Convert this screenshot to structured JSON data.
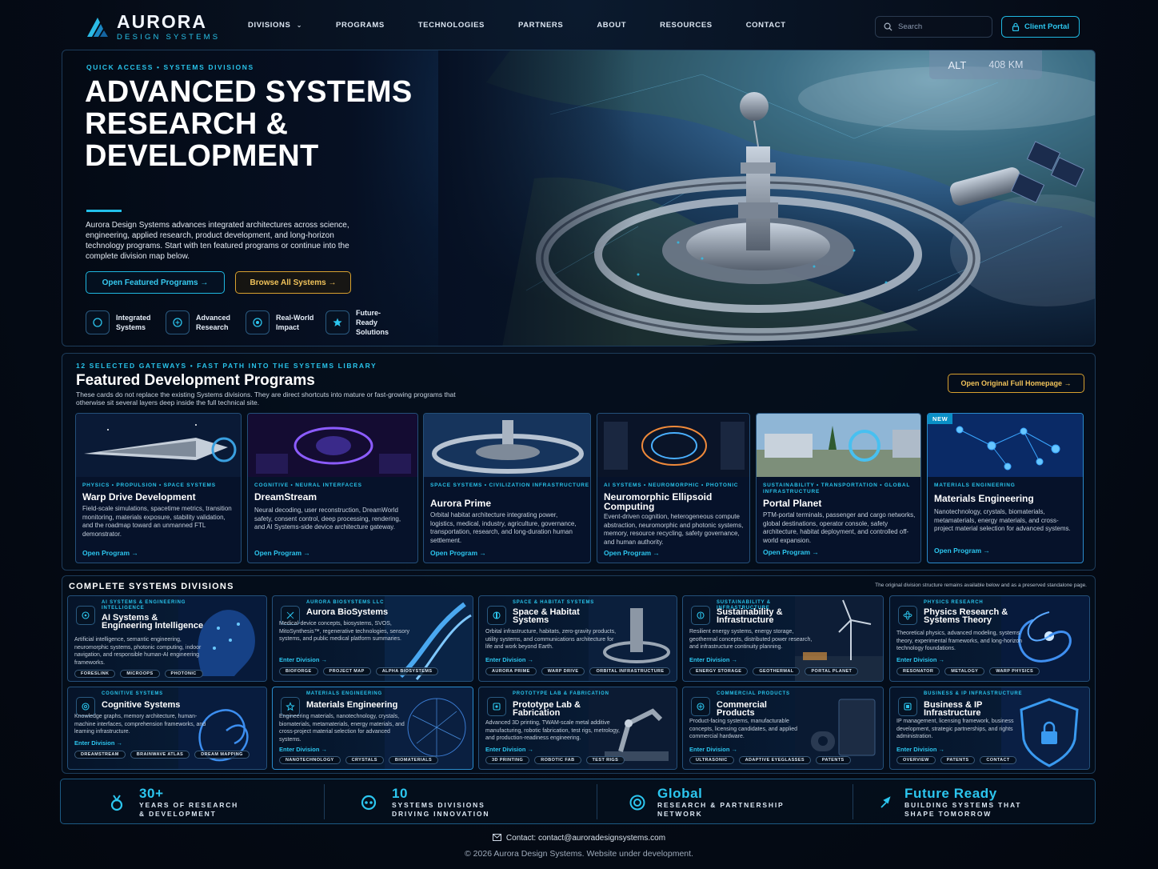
{
  "brand": {
    "name": "AURORA",
    "sub": "DESIGN SYSTEMS",
    "accent": "#28c3ea",
    "gold": "#d8a12f"
  },
  "nav": {
    "items": [
      "DIVISIONS",
      "PROGRAMS",
      "TECHNOLOGIES",
      "PARTNERS",
      "ABOUT",
      "RESOURCES",
      "CONTACT"
    ],
    "search_placeholder": "Search",
    "portal": "Client Portal"
  },
  "hero": {
    "kicker": "QUICK ACCESS • SYSTEMS DIVISIONS",
    "title": "ADVANCED SYSTEMS RESEARCH & DEVELOPMENT",
    "description": "Aurora Design Systems advances integrated architectures across science, engineering, applied research, product development, and long-horizon technology programs. Start with ten featured programs or continue into the complete division map below.",
    "btn_primary": "Open Featured Programs →",
    "btn_secondary": "Browse All Systems →",
    "alt_label": "ALT",
    "alt_value": "408 KM",
    "badges": [
      "Integrated Systems",
      "Advanced Research",
      "Real-World Impact",
      "Future-Ready Solutions"
    ]
  },
  "featured": {
    "kicker": "12 SELECTED GATEWAYS • FAST PATH INTO THE SYSTEMS LIBRARY",
    "title": "Featured Development Programs",
    "description": "These cards do not replace the existing Systems divisions. They are direct shortcuts into mature or fast-growing programs that otherwise sit several layers deep inside the full technical site.",
    "button": "Open Original Full Homepage →",
    "cards": [
      {
        "tag": "PHYSICS • PROPULSION • SPACE SYSTEMS",
        "title": "Warp Drive Development",
        "desc": "Field-scale simulations, spacetime metrics, transition monitoring, materials exposure, stability validation, and the roadmap toward an unmanned FTL demonstrator.",
        "link": "Open Program →"
      },
      {
        "tag": "COGNITIVE • NEURAL INTERFACES",
        "title": "DreamStream",
        "desc": "Neural decoding, user reconstruction, DreamWorld safety, consent control, deep processing, rendering, and AI Systems-side device architecture gateway.",
        "link": "Open Program →"
      },
      {
        "tag": "SPACE SYSTEMS • CIVILIZATION INFRASTRUCTURE",
        "title": "Aurora Prime",
        "desc": "Orbital habitat architecture integrating power, logistics, medical, industry, agriculture, governance, transportation, research, and long-duration human settlement.",
        "link": "Open Program →"
      },
      {
        "tag": "AI SYSTEMS • NEUROMORPHIC • PHOTONIC",
        "title": "Neuromorphic Ellipsoid Computing",
        "desc": "Event-driven cognition, heterogeneous compute abstraction, neuromorphic and photonic systems, memory, resource recycling, safety governance, and human authority.",
        "link": "Open Program →"
      },
      {
        "tag": "SUSTAINABILITY • TRANSPORTATION • GLOBAL INFRASTRUCTURE",
        "title": "Portal Planet",
        "desc": "PTM-portal terminals, passenger and cargo networks, global destinations, operator console, safety architecture, habitat deployment, and controlled off-world expansion.",
        "link": "Open Program →"
      },
      {
        "tag": "MATERIALS ENGINEERING",
        "title": "Materials Engineering",
        "desc": "Nanotechnology, crystals, biomaterials, metamaterials, energy materials, and cross-project material selection for advanced systems.",
        "link": "Open Program →",
        "badge": "NEW"
      }
    ]
  },
  "divisions": {
    "title": "COMPLETE SYSTEMS DIVISIONS",
    "note": "The original division structure remains available below and as a preserved standalone page.",
    "cards": [
      {
        "tag": "AI SYSTEMS & ENGINEERING INTELLIGENCE",
        "title": "AI Systems & Engineering Intelligence",
        "desc": "Artificial intelligence, semantic engineering, neuromorphic systems, photonic computing, indoor navigation, and responsible human-AI engineering frameworks.",
        "link": "",
        "chips": [
          "FORESLINK",
          "MICROOPS",
          "PHOTONIC"
        ],
        "icon": "ai-icon"
      },
      {
        "tag": "AURORA BIOSYSTEMS LLC",
        "title": "Aurora BioSystems",
        "desc": "Medical-device concepts, biosystems, SVOS, MitoSynthesis™, regenerative technologies, sensory systems, and public medical platform summaries.",
        "link": "Enter Division →",
        "chips": [
          "BIOFORGE",
          "PROJECT MAP",
          "ALPHA BIOSYSTEMS"
        ],
        "icon": "bio-icon"
      },
      {
        "tag": "SPACE & HABITAT SYSTEMS",
        "title": "Space & Habitat Systems",
        "desc": "Orbital infrastructure, habitats, zero-gravity products, utility systems, and communications architecture for life and work beyond Earth.",
        "link": "Enter Division →",
        "chips": [
          "AURORA PRIME",
          "WARP DRIVE",
          "ORBITAL INFRASTRUCTURE"
        ],
        "icon": "habitat-icon"
      },
      {
        "tag": "SUSTAINABILITY & INFRASTRUCTURE",
        "title": "Sustainability & Infrastructure",
        "desc": "Resilient energy systems, energy storage, geothermal concepts, distributed power research, and infrastructure continuity planning.",
        "link": "Enter Division →",
        "chips": [
          "ENERGY STORAGE",
          "GEOTHERMAL",
          "PORTAL PLANET"
        ],
        "icon": "energy-icon"
      },
      {
        "tag": "PHYSICS RESEARCH",
        "title": "Physics Research & Systems Theory",
        "desc": "Theoretical physics, advanced modeling, systems theory, experimental frameworks, and long-horizon technology foundations.",
        "link": "Enter Division →",
        "chips": [
          "RESONATOR",
          "METALOGY",
          "WARP PHYSICS"
        ],
        "icon": "physics-icon"
      },
      {
        "tag": "COGNITIVE SYSTEMS",
        "title": "Cognitive Systems",
        "desc": "Knowledge graphs, memory architecture, human-machine interfaces, comprehension frameworks, and learning infrastructure.",
        "link": "Enter Division →",
        "chips": [
          "DREAMSTREAM",
          "BRAINWAVE ATLAS",
          "DREAM MAPPING"
        ],
        "icon": "cognitive-icon"
      },
      {
        "tag": "MATERIALS ENGINEERING",
        "title": "Materials Engineering",
        "desc": "Engineering materials, nanotechnology, crystals, biomaterials, metamaterials, energy materials, and cross-project material selection for advanced systems.",
        "link": "Enter Division →",
        "chips": [
          "NANOTECHNOLOGY",
          "CRYSTALS",
          "BIOMATERIALS"
        ],
        "icon": "materials-icon"
      },
      {
        "tag": "PROTOTYPE LAB & FABRICATION",
        "title": "Prototype Lab & Fabrication",
        "desc": "Advanced 3D printing, TWAM-scale metal additive manufacturing, robotic fabrication, test rigs, metrology, and production-readiness engineering.",
        "link": "Enter Division →",
        "chips": [
          "3D PRINTING",
          "ROBOTIC FAB",
          "TEST RIGS"
        ],
        "icon": "fabrication-icon"
      },
      {
        "tag": "COMMERCIAL PRODUCTS",
        "title": "Commercial Products",
        "desc": "Product-facing systems, manufacturable concepts, licensing candidates, and applied commercial hardware.",
        "link": "Enter Division →",
        "chips": [
          "ULTRASONIC",
          "ADAPTIVE EYEGLASSES",
          "PATENTS"
        ],
        "icon": "products-icon"
      },
      {
        "tag": "BUSINESS & IP INFRASTRUCTURE",
        "title": "Business & IP Infrastructure",
        "desc": "IP management, licensing framework, business development, strategic partnerships, and rights administration.",
        "link": "Enter Division →",
        "chips": [
          "OVERVIEW",
          "PATENTS",
          "CONTACT"
        ],
        "icon": "business-icon"
      }
    ]
  },
  "stats": [
    {
      "value": "30+",
      "label": "YEARS OF RESEARCH & DEVELOPMENT",
      "icon": "medal-icon"
    },
    {
      "value": "10",
      "label": "SYSTEMS DIVISIONS DRIVING INNOVATION",
      "icon": "network-icon"
    },
    {
      "value": "Global",
      "label": "RESEARCH & PARTNERSHIP NETWORK",
      "icon": "target-icon"
    },
    {
      "value": "Future Ready",
      "label": "BUILDING SYSTEMS THAT SHAPE TOMORROW",
      "icon": "rocket-icon"
    }
  ],
  "footer": {
    "contact": "Contact: contact@auroradesignsystems.com",
    "copyright": "© 2026 Aurora Design Systems. Website under development."
  }
}
